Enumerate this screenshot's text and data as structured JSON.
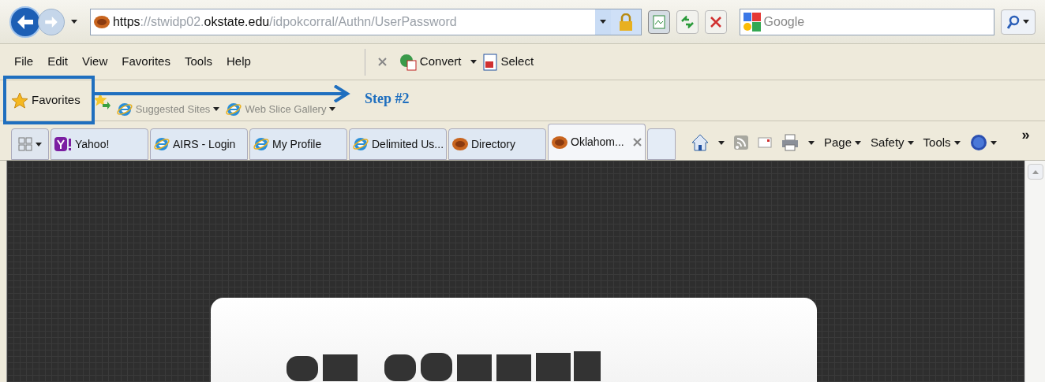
{
  "address_bar": {
    "url_parts": [
      {
        "text": "https",
        "emphasis": true
      },
      {
        "text": "://stwidp02.",
        "emphasis": false
      },
      {
        "text": "okstate.edu",
        "emphasis": true
      },
      {
        "text": "/idpokcorral/Authn/UserPassword",
        "emphasis": false
      }
    ]
  },
  "search": {
    "placeholder": "Google"
  },
  "menu": [
    "File",
    "Edit",
    "View",
    "Favorites",
    "Tools",
    "Help"
  ],
  "addon_toolbar": [
    "Convert",
    "Select"
  ],
  "favorites_bar": {
    "button": "Favorites",
    "links": [
      {
        "label": "Suggested Sites",
        "disabled": true
      },
      {
        "label": "Web Slice Gallery",
        "disabled": true
      }
    ]
  },
  "tabs": [
    {
      "label": "Yahoo!",
      "kind": "yahoo",
      "selected": false
    },
    {
      "label": "AIRS - Login",
      "kind": "ie",
      "selected": false
    },
    {
      "label": "My Profile",
      "kind": "ie",
      "selected": false
    },
    {
      "label": "Delimited Us...",
      "kind": "ie",
      "selected": false
    },
    {
      "label": "Directory",
      "kind": "osu",
      "selected": false
    },
    {
      "label": "Oklahom...",
      "kind": "osu",
      "selected": true
    }
  ],
  "command_bar": [
    "Page",
    "Safety",
    "Tools"
  ],
  "overflow": "»",
  "annotation": {
    "label": "Step #2"
  }
}
